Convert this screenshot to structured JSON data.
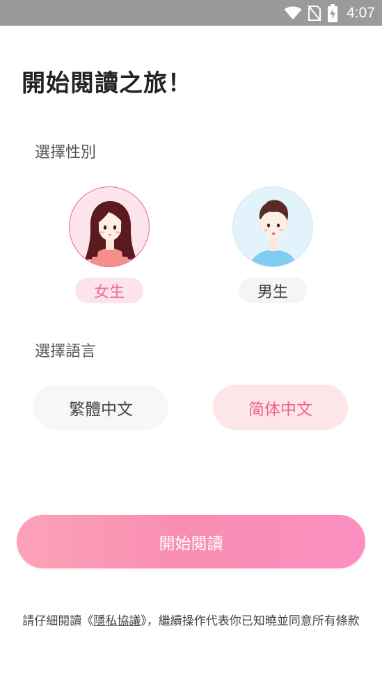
{
  "status_bar": {
    "time": "4:07",
    "icons": [
      "wifi-icon",
      "no-sim-icon",
      "battery-charging-icon"
    ]
  },
  "title": "開始閱讀之旅！",
  "gender": {
    "label": "選擇性別",
    "female": {
      "label": "女生",
      "avatar": "female-avatar",
      "selected": true
    },
    "male": {
      "label": "男生",
      "avatar": "male-avatar",
      "selected": false
    }
  },
  "language": {
    "label": "選擇語言",
    "options": [
      {
        "label": "繁體中文",
        "selected": false
      },
      {
        "label": "简体中文",
        "selected": true
      }
    ]
  },
  "start_button": {
    "label": "開始閱讀"
  },
  "footer": {
    "prefix": "請仔細閱讀《",
    "link": "隱私協議",
    "suffix": "》，繼續操作代表你已知曉並同意所有條款"
  },
  "colors": {
    "accent_pink": "#f26b98",
    "status_bar": "#9a9a9a"
  }
}
